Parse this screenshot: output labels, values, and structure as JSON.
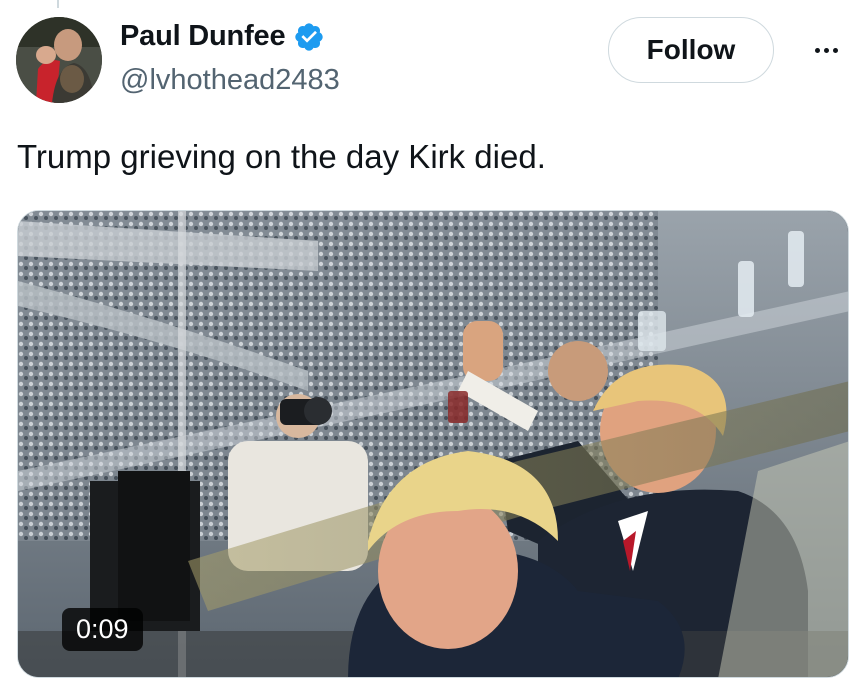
{
  "author": {
    "display_name": "Paul Dunfee",
    "handle": "@lvhothead2483",
    "verified": true,
    "verified_color": "#1d9bf0"
  },
  "actions": {
    "follow_label": "Follow",
    "more_icon": "more-horizontal-icon"
  },
  "tweet": {
    "text": "Trump grieving on the day Kirk died."
  },
  "media": {
    "type": "video",
    "duration": "0:09"
  }
}
